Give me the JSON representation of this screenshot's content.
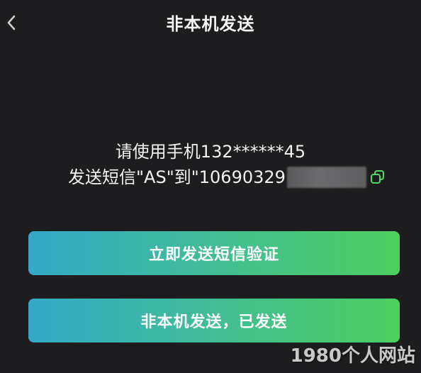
{
  "header": {
    "title": "非本机发送"
  },
  "instruction": {
    "line1": "请使用手机132******45",
    "line2": "发送短信\"AS\"到\"10690329"
  },
  "buttons": {
    "send_sms_label": "立即发送短信验证",
    "sent_label": "非本机发送，已发送"
  },
  "watermark": {
    "text": "1980个人网站"
  },
  "colors": {
    "background": "#1d1d1f",
    "button_gradient_start": "#34a8c8",
    "button_gradient_end": "#4ed05f",
    "copy_icon": "#4cd964"
  },
  "icons": {
    "back": "chevron-left-icon",
    "copy": "copy-icon"
  }
}
